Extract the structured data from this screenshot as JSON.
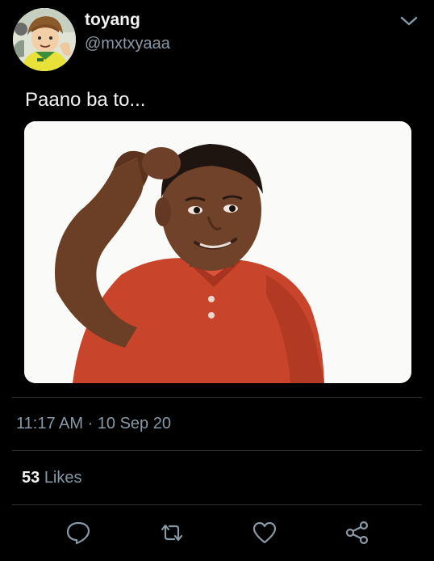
{
  "tweet": {
    "author_name": "toyang",
    "author_handle": "@mxtxyaaa",
    "text": "Paano ba to...",
    "timestamp": "11:17 AM · 10 Sep 20",
    "likes_count": "53",
    "likes_label": "Likes"
  },
  "icons": {
    "more": "chevron-down-icon",
    "reply": "reply-icon",
    "retweet": "retweet-icon",
    "like": "heart-icon",
    "share": "share-icon"
  },
  "colors": {
    "background": "#000000",
    "primary_text": "#f2f2f2",
    "secondary_text": "#8899a6",
    "divider": "#2f3336"
  }
}
